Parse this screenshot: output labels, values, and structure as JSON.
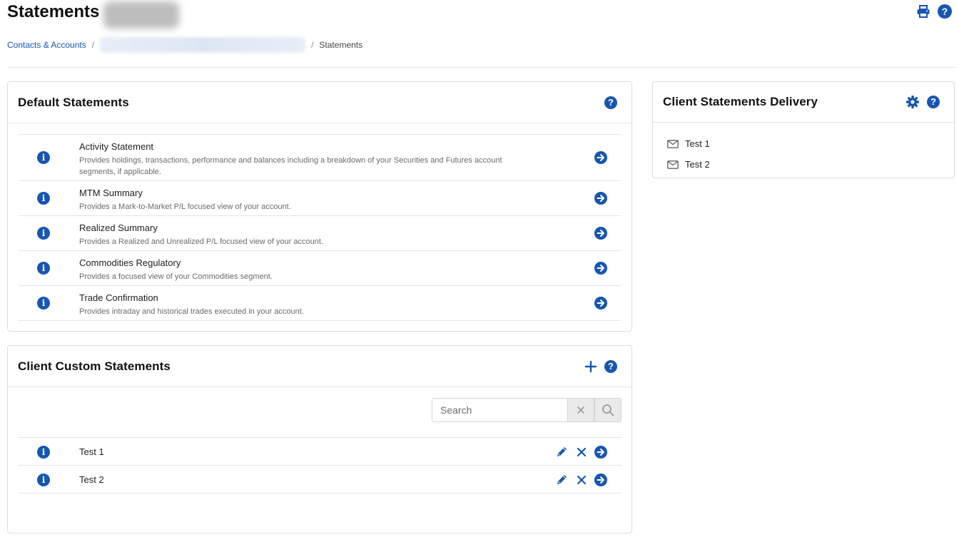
{
  "page": {
    "title": "Statements",
    "breadcrumb": {
      "root": "Contacts & Accounts",
      "separator": "/",
      "current": "Statements"
    }
  },
  "default_statements": {
    "title": "Default Statements",
    "items": [
      {
        "name": "Activity Statement",
        "description": "Provides holdings, transactions, performance and balances including a breakdown of your Securities and Futures account segments, if applicable."
      },
      {
        "name": "MTM Summary",
        "description": "Provides a Mark-to-Market P/L focused view of your account."
      },
      {
        "name": "Realized Summary",
        "description": "Provides a Realized and Unrealized P/L focused view of your account."
      },
      {
        "name": "Commodities Regulatory",
        "description": "Provides a focused view of your Commodities segment."
      },
      {
        "name": "Trade Confirmation",
        "description": "Provides intraday and historical trades executed in your account."
      }
    ]
  },
  "custom_statements": {
    "title": "Client Custom Statements",
    "search_placeholder": "Search",
    "items": [
      {
        "name": "Test 1"
      },
      {
        "name": "Test 2"
      }
    ]
  },
  "delivery": {
    "title": "Client Statements Delivery",
    "items": [
      {
        "name": "Test 1"
      },
      {
        "name": "Test 2"
      }
    ]
  },
  "colors": {
    "accent": "#1656b0",
    "divider": "#e4e4e4",
    "text_muted": "#6b6b6b"
  },
  "icons": {
    "print": "printer-icon",
    "help": "question-circle-icon",
    "info": "info-circle-icon",
    "open": "arrow-circle-right-icon",
    "add": "plus-icon",
    "settings": "gear-icon",
    "edit": "pencil-icon",
    "delete": "close-icon",
    "email": "envelope-icon",
    "search": "search-icon"
  }
}
